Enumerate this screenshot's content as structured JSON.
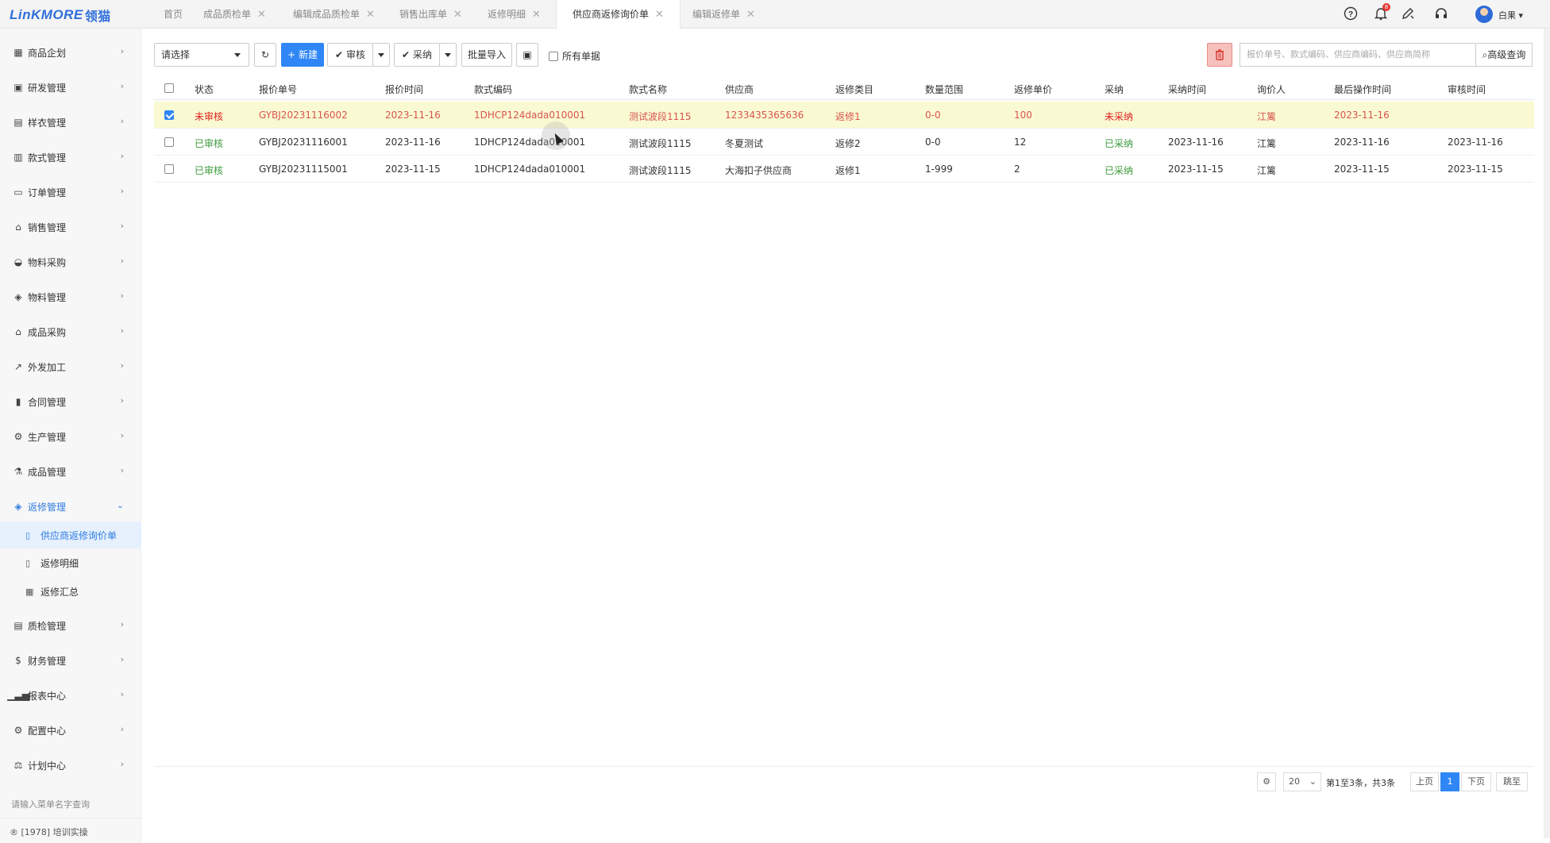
{
  "app": {
    "logo_latin": "LinKMORE",
    "logo_cn": "领猫",
    "brand_color": "#2f6fdb",
    "accent_color": "#2f86f6"
  },
  "tabs": [
    {
      "label": "首页",
      "closable": false
    },
    {
      "label": "成品质检单",
      "closable": true
    },
    {
      "label": "编辑成品质检单",
      "closable": true
    },
    {
      "label": "销售出库单",
      "closable": true
    },
    {
      "label": "返修明细",
      "closable": true
    },
    {
      "label": "供应商返修询价单",
      "closable": true,
      "active": true
    },
    {
      "label": "编辑返修单",
      "closable": true
    }
  ],
  "header": {
    "icons": [
      "help-icon",
      "bell-icon",
      "edit-pen-icon",
      "headset-icon"
    ],
    "notification_count": "8",
    "user_name": "白果"
  },
  "sidebar": {
    "items": [
      {
        "label": "商品企划",
        "icon": "calendar-icon"
      },
      {
        "label": "研发管理",
        "icon": "image-icon"
      },
      {
        "label": "样衣管理",
        "icon": "id-card-icon"
      },
      {
        "label": "款式管理",
        "icon": "shirt-icon"
      },
      {
        "label": "订单管理",
        "icon": "document-icon"
      },
      {
        "label": "销售管理",
        "icon": "bank-icon"
      },
      {
        "label": "物料采购",
        "icon": "basket-icon"
      },
      {
        "label": "物料管理",
        "icon": "cubes-icon"
      },
      {
        "label": "成品采购",
        "icon": "bank-icon"
      },
      {
        "label": "外发加工",
        "icon": "external-link-icon"
      },
      {
        "label": "合同管理",
        "icon": "contract-icon"
      },
      {
        "label": "生产管理",
        "icon": "gears-icon"
      },
      {
        "label": "成品管理",
        "icon": "flask-icon"
      },
      {
        "label": "返修管理",
        "icon": "cubes-icon",
        "open": true
      },
      {
        "label": "质检管理",
        "icon": "keyboard-icon"
      },
      {
        "label": "财务管理",
        "icon": "dollar-icon"
      },
      {
        "label": "报表中心",
        "icon": "bar-chart-icon"
      },
      {
        "label": "配置中心",
        "icon": "gears-icon"
      },
      {
        "label": "计划中心",
        "icon": "balance-icon"
      }
    ],
    "sub_items": [
      {
        "label": "供应商返修询价单",
        "icon": "file-icon",
        "active": true
      },
      {
        "label": "返修明细",
        "icon": "file-text-icon"
      },
      {
        "label": "返修汇总",
        "icon": "table-icon"
      }
    ],
    "menu_search_placeholder": "请输入菜单名字查询",
    "footer": "[1978] 培训实操"
  },
  "toolbar": {
    "select_placeholder": "请选择",
    "new_label": "新建",
    "audit_label": "审核",
    "adopt_label": "采纳",
    "batch_import_label": "批量导入",
    "all_docs_label": "所有单据",
    "search_placeholder": "报价单号、款式编码、供应商编码、供应商简称",
    "advanced_search_label": "高级查询"
  },
  "table": {
    "columns": [
      "状态",
      "报价单号",
      "报价时间",
      "款式编码",
      "款式名称",
      "供应商",
      "返修类目",
      "数量范围",
      "返修单价",
      "采纳",
      "采纳时间",
      "询价人",
      "最后操作时间",
      "审核时间"
    ],
    "rows": [
      {
        "selected": true,
        "cells": [
          "未审核",
          "GYBJ20231116002",
          "2023-11-16",
          "1DHCP124dada010001",
          "测试波段1115",
          "1233435365636",
          "返修1",
          "0-0",
          "100",
          "未采纳",
          "",
          "江篱",
          "2023-11-16",
          ""
        ]
      },
      {
        "selected": false,
        "cells": [
          "已审核",
          "GYBJ20231116001",
          "2023-11-16",
          "1DHCP124dada010001",
          "测试波段1115",
          "冬夏测试",
          "返修2",
          "0-0",
          "12",
          "已采纳",
          "2023-11-16",
          "江篱",
          "2023-11-16",
          "2023-11-16"
        ]
      },
      {
        "selected": false,
        "cells": [
          "已审核",
          "GYBJ20231115001",
          "2023-11-15",
          "1DHCP124dada010001",
          "测试波段1115",
          "大海扣子供应商",
          "返修1",
          "1-999",
          "2",
          "已采纳",
          "2023-11-15",
          "江篱",
          "2023-11-15",
          "2023-11-15"
        ]
      }
    ]
  },
  "pagination": {
    "page_size": "20",
    "summary": "第1至3条，共3条",
    "prev_label": "上页",
    "current_page": "1",
    "next_label": "下页",
    "jump_label": "跳至"
  }
}
